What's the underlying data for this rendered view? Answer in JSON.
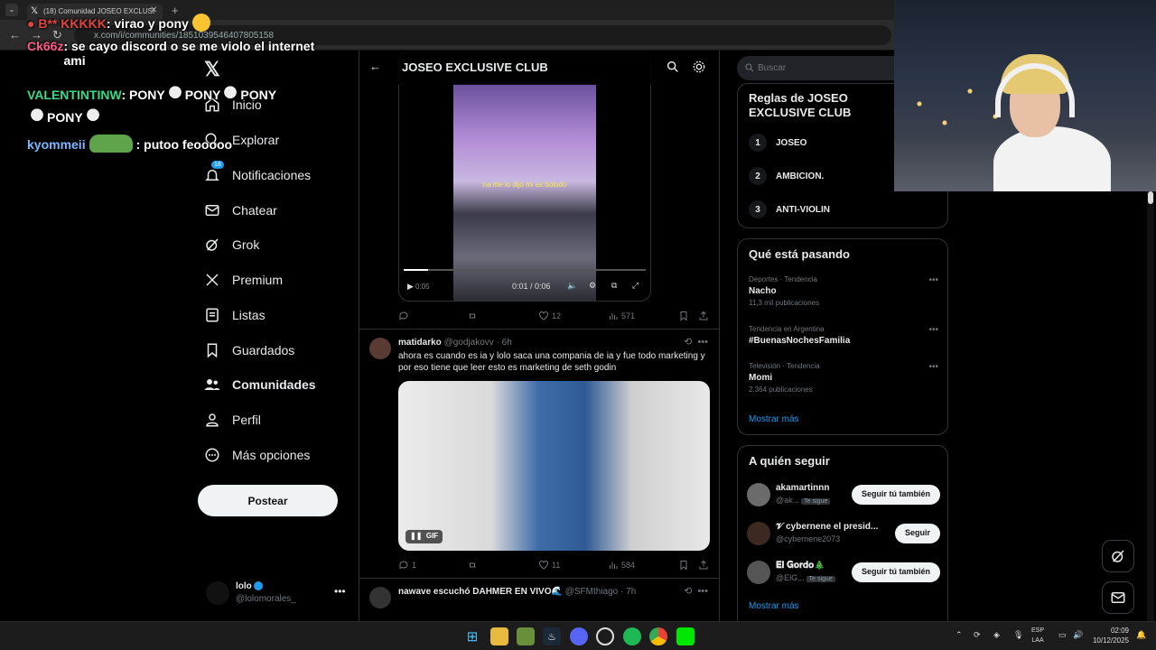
{
  "browser": {
    "tab_title": "(18) Comunidad JOSEO EXCLUSI",
    "url": "x.com/i/communities/1851039546407805158"
  },
  "chat": [
    {
      "user": "B** KKKKK",
      "text": ": virao y pony",
      "color": "#e0463f"
    },
    {
      "user": "Ck66z",
      "text": ": se cayo discord o se me violo el internet ami",
      "color": "#ff5a8a"
    },
    {
      "user": "VALENTINTINW",
      "text": ": PONY",
      "text2": "PONY",
      "text3": "PONY",
      "text4": "PONY",
      "color": "#39d98a"
    },
    {
      "user": "kyommeii",
      "text": ": putoo feooooo",
      "color": "#7ab8ff"
    }
  ],
  "sidebar": {
    "items": [
      {
        "label": "Inicio",
        "icon": "home-icon"
      },
      {
        "label": "Explorar",
        "icon": "search-icon"
      },
      {
        "label": "Notificaciones",
        "icon": "bell-icon",
        "badge": "18"
      },
      {
        "label": "Chatear",
        "icon": "mail-icon"
      },
      {
        "label": "Grok",
        "icon": "grok-icon"
      },
      {
        "label": "Premium",
        "icon": "x-icon"
      },
      {
        "label": "Listas",
        "icon": "list-icon"
      },
      {
        "label": "Guardados",
        "icon": "bookmark-icon"
      },
      {
        "label": "Comunidades",
        "icon": "people-icon"
      },
      {
        "label": "Perfil",
        "icon": "person-icon"
      },
      {
        "label": "Más opciones",
        "icon": "more-icon"
      }
    ],
    "post_label": "Postear",
    "account": {
      "name": "lolo",
      "handle": "@lolomorales_"
    }
  },
  "main": {
    "title": "JOSEO EXCLUSIVE CLUB",
    "video": {
      "caption": "na me lo dijo mi ex boludo",
      "time": "0:01 / 0:06",
      "side_time": "0:05",
      "progress": 0.1
    },
    "tweet1_actions": {
      "replies": "",
      "retweets": "",
      "likes": "12",
      "views": "571"
    },
    "tweet2": {
      "name": "matidarko",
      "handle": "@godjakovv",
      "time": "· 6h",
      "text": "ahora es cuando es ia y lolo saca una compania de ia y fue todo marketing y por eso tiene que leer esto es marketing de seth godin",
      "gif_label": "GIF",
      "replies": "1",
      "retweets": "",
      "likes": "11",
      "views": "584"
    },
    "tweet3": {
      "name": "nawave escuchó DAHMER EN VIVO",
      "handle": "@SFMthiago",
      "time": "· 7h"
    }
  },
  "right": {
    "search_placeholder": "Buscar",
    "rules_title": "Reglas de JOSEO EXCLUSIVE CLUB",
    "rules": [
      {
        "num": "1",
        "label": "JOSEO"
      },
      {
        "num": "2",
        "label": "AMBICION."
      },
      {
        "num": "3",
        "label": "ANTI-VIOLIN"
      }
    ],
    "trends_title": "Qué está pasando",
    "trends": [
      {
        "context": "Deportes · Tendencia",
        "name": "Nacho",
        "count": "11,3 mil publicaciones"
      },
      {
        "context": "Tendencia en Argentina",
        "name": "#BuenasNochesFamilia",
        "count": ""
      },
      {
        "context": "Televisión · Tendencia",
        "name": "Momi",
        "count": "2.364 publicaciones"
      }
    ],
    "show_more": "Mostrar más",
    "follow_title": "A quién seguir",
    "follow": [
      {
        "name": "akamartinnn",
        "handle": "@ak...",
        "tag": "Te sigue",
        "button": "Seguir tú también"
      },
      {
        "name": "𝓥 cybernene el presid...",
        "handle": "@cybernene2073",
        "tag": "",
        "button": "Seguir"
      },
      {
        "name": "𝐄𝐥 𝐆𝐨𝐫𝐝𝐨🎄",
        "handle": "@ElG...",
        "tag": "Te sigue",
        "button": "Seguir tú también"
      }
    ],
    "follow_more": "Mostrar más"
  },
  "taskbar": {
    "lang_top": "ESP",
    "lang_bottom": "LAA",
    "time": "02:09",
    "date": "10/12/2025"
  }
}
